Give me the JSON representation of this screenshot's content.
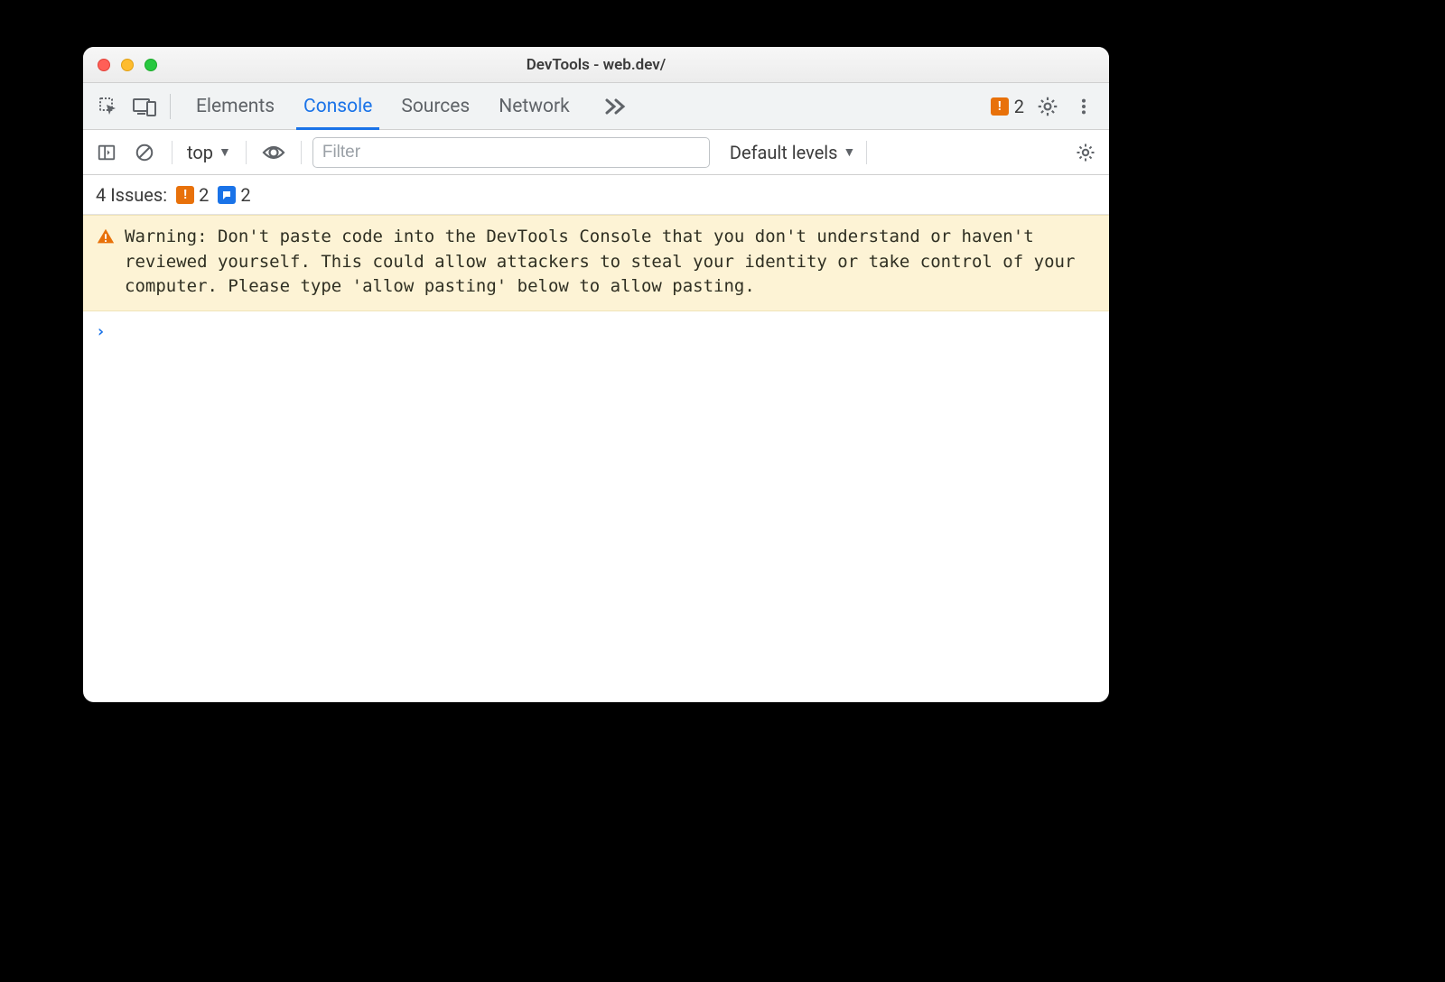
{
  "window": {
    "title": "DevTools - web.dev/"
  },
  "tabs": {
    "elements": "Elements",
    "console": "Console",
    "sources": "Sources",
    "network": "Network"
  },
  "tabbar": {
    "issue_badge_count": "2"
  },
  "subbar": {
    "context": "top",
    "filter_placeholder": "Filter",
    "levels": "Default levels"
  },
  "issues": {
    "label": "4 Issues:",
    "warn_count": "2",
    "info_count": "2"
  },
  "warning": {
    "text": "Warning: Don't paste code into the DevTools Console that you don't understand or haven't reviewed yourself. This could allow attackers to steal your identity or take control of your computer. Please type 'allow pasting' below to allow pasting."
  },
  "prompt": {
    "caret": "›"
  }
}
